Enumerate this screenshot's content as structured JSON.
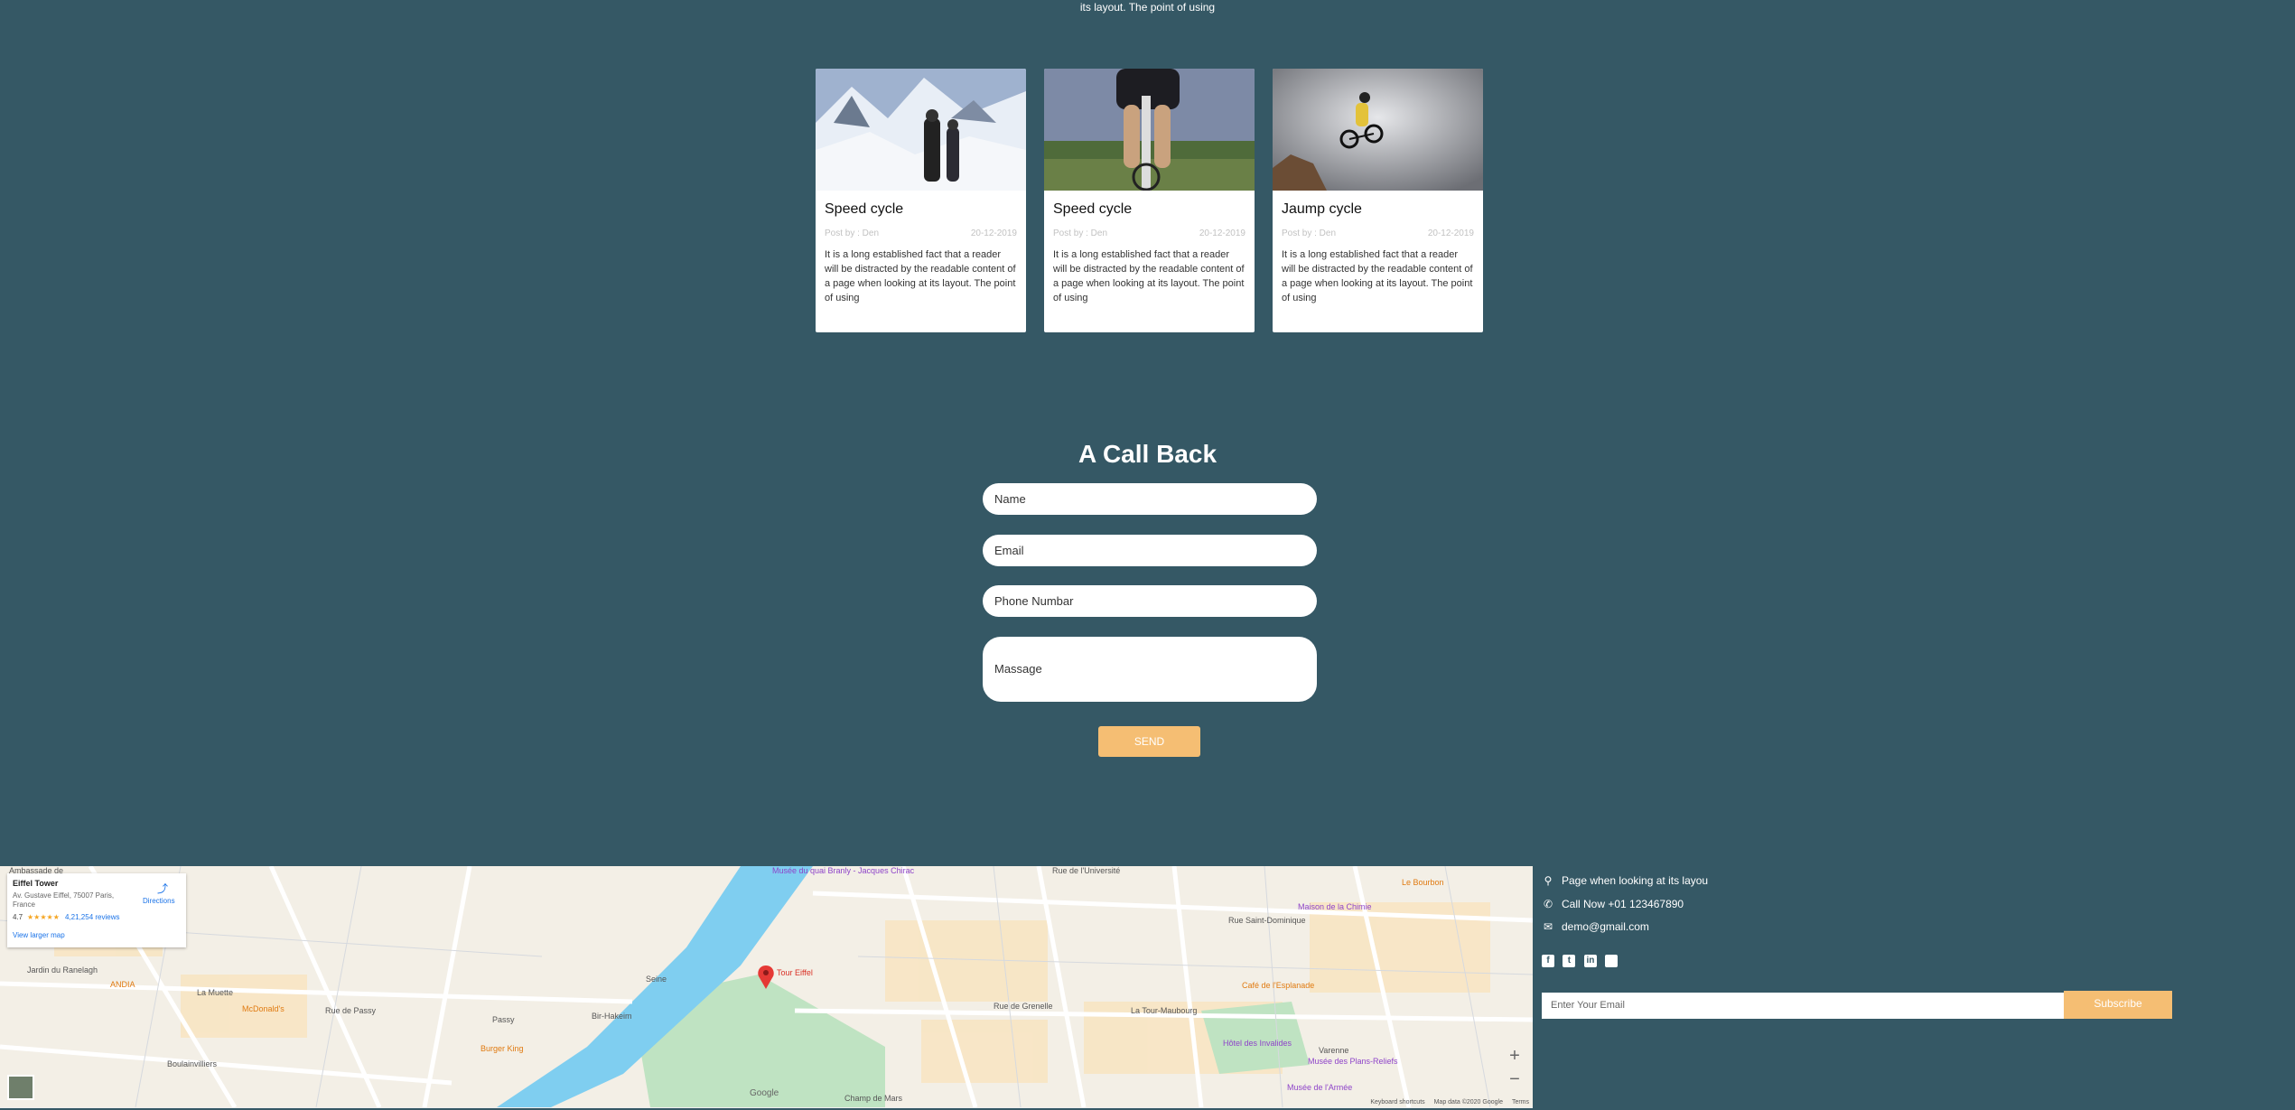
{
  "top_snippet": "its layout. The point of using",
  "cards": [
    {
      "title": "Speed cycle",
      "author": "Post by : Den",
      "date": "20-12-2019",
      "desc": "It is a long established fact that a reader will be distracted by the readable content of a page when looking at its layout. The point of using"
    },
    {
      "title": "Speed cycle",
      "author": "Post by : Den",
      "date": "20-12-2019",
      "desc": "It is a long established fact that a reader will be distracted by the readable content of a page when looking at its layout. The point of using"
    },
    {
      "title": "Jaump cycle",
      "author": "Post by : Den",
      "date": "20-12-2019",
      "desc": "It is a long established fact that a reader will be distracted by the readable content of a page when looking at its layout. The point of using"
    }
  ],
  "form": {
    "title": "A Call Back",
    "name_placeholder": "Name",
    "email_placeholder": "Email",
    "phone_placeholder": "Phone Numbar",
    "message_placeholder": "Massage",
    "send_label": "SEND"
  },
  "map": {
    "place_name": "Eiffel Tower",
    "place_address": "Av. Gustave Eiffel, 75007 Paris, France",
    "rating": "4.7",
    "stars": "★★★★★",
    "reviews": "4,21,254 reviews",
    "view_larger": "View larger map",
    "directions": "Directions",
    "zoom_in": "+",
    "zoom_out": "−",
    "google": "Google",
    "footer_shortcuts": "Keyboard shortcuts",
    "footer_data": "Map data ©2020 Google",
    "footer_terms": "Terms",
    "marker_label": "Tour Eiffel",
    "labels": {
      "passy": "Passy",
      "la_muette": "La Muette",
      "ranelagh": "Jardin du Ranelagh",
      "mcdonalds": "McDonald's",
      "burger_king": "Burger King",
      "boulainvilliers": "Boulainvilliers",
      "bir_hakeim": "Bir-Hakeim",
      "champ_de_mars": "Champ de Mars",
      "la_tour_maubourg": "La Tour-Maubourg",
      "rue_st_dominique": "Rue Saint-Dominique",
      "cafe_esplanade": "Café de l'Esplanade",
      "maison_chimie": "Maison de la Chimie",
      "le_bourbon": "Le Bourbon",
      "hotel_invalides": "Hôtel des Invalides",
      "varenne": "Varenne",
      "musee_rodin": "Musée des Plans-Reliefs",
      "musee_armee": "Musée de l'Armée",
      "musee_quai_branly": "Musée du quai Branly - Jacques Chirac",
      "andia": "ANDIA",
      "la_seine": "Seine",
      "rue_universite": "Rue de l'Université",
      "rue_de_grenelle": "Rue de Grenelle",
      "rue_de_passy": "Rue de Passy",
      "ambassade": "Ambassade de"
    }
  },
  "footer": {
    "address": "Page when looking at its layou",
    "phone": "Call Now +01 123467890",
    "email": "demo@gmail.com",
    "email_placeholder": "Enter Your Email",
    "subscribe_label": "Subscribe",
    "social_icons": [
      "facebook-icon",
      "twitter-icon",
      "linkedin-icon",
      "instagram-icon"
    ]
  },
  "colors": {
    "background": "#355865",
    "accent": "#f5be73",
    "water": "#7fcef0",
    "park": "#bfe3c2"
  }
}
